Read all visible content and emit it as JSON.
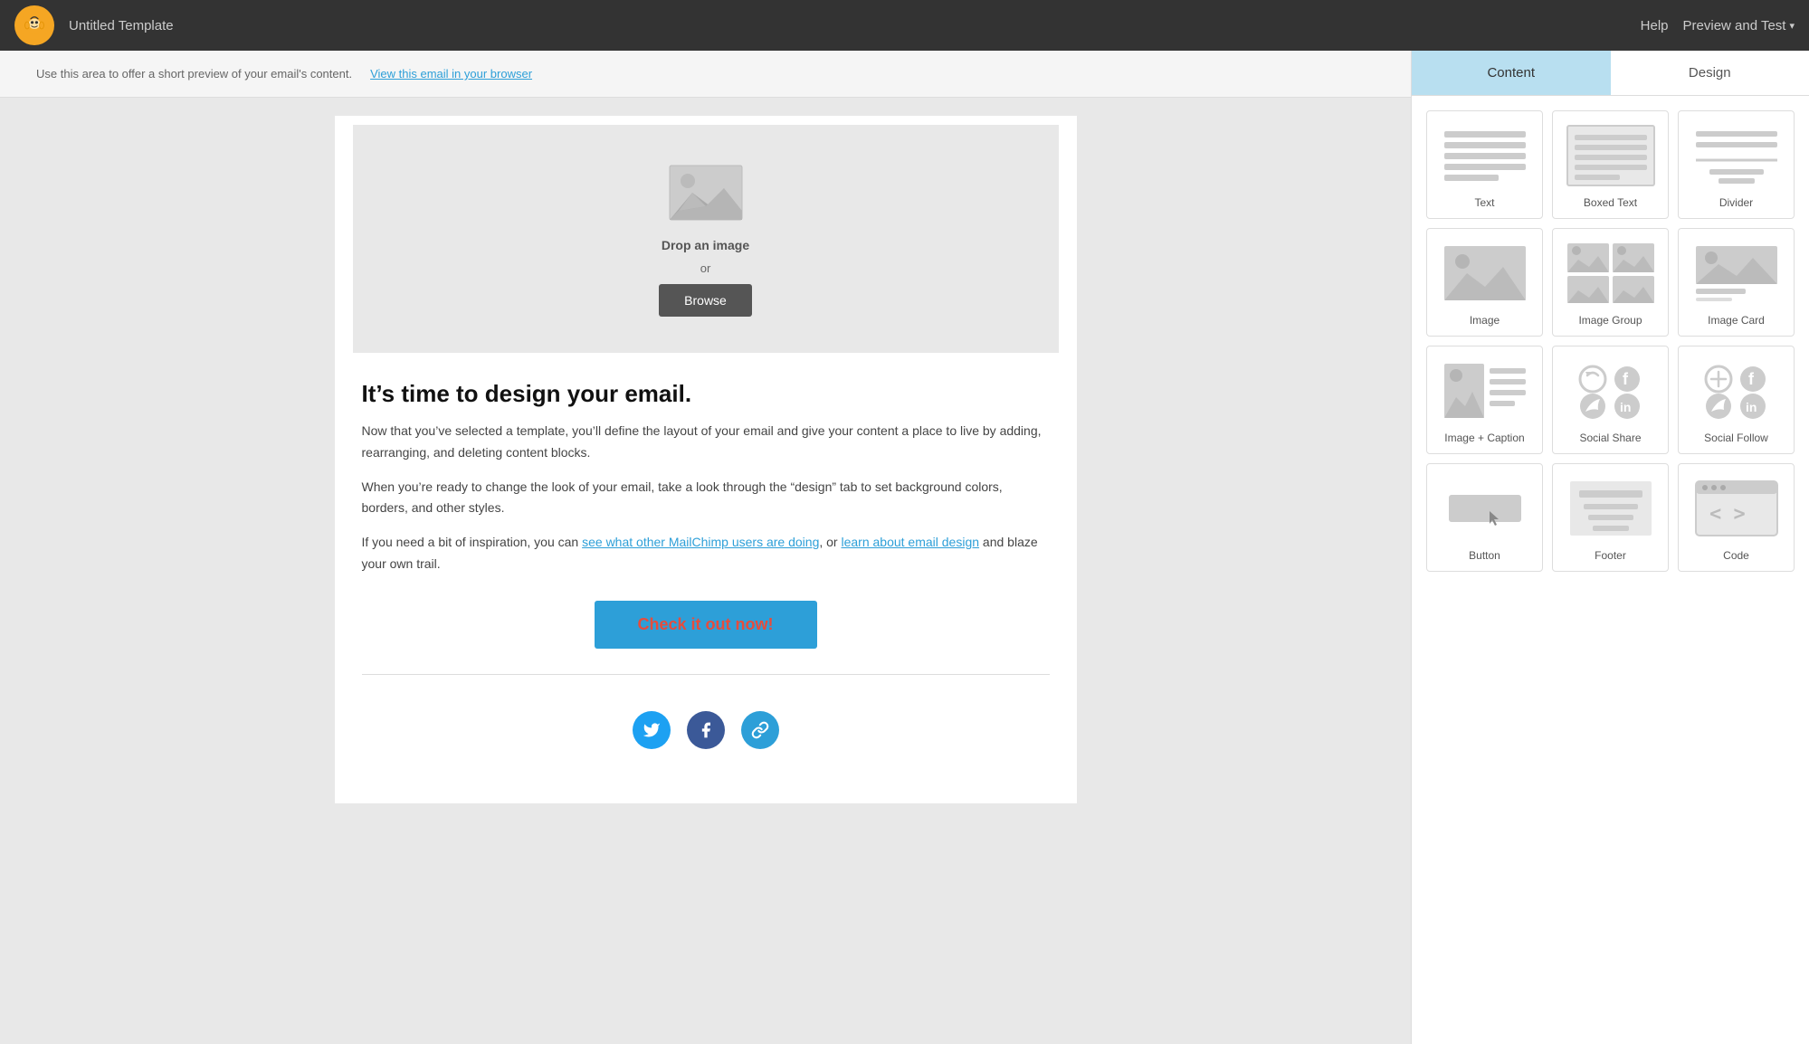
{
  "topnav": {
    "title": "Untitled Template",
    "help_label": "Help",
    "preview_label": "Preview and Test"
  },
  "preheader": {
    "text": "Use this area to offer a short preview of your email's content.",
    "link_text": "View this email in your browser"
  },
  "dropzone": {
    "drop_text": "Drop an image",
    "drop_or": "or",
    "browse_label": "Browse"
  },
  "email_content": {
    "heading": "It’s time to design your email.",
    "para1": "Now that you’ve selected a template, you’ll define the layout of your email and give your content a place to live by adding, rearranging, and deleting content blocks.",
    "para2": "When you’re ready to change the look of your email, take a look through the “design” tab to set background colors, borders, and other styles.",
    "para3_prefix": "If you need a bit of inspiration, you can ",
    "link1_text": "see what other MailChimp users are doing",
    "para3_mid": ", or ",
    "link2_text": "learn about email design",
    "para3_suffix": " and blaze your own trail.",
    "cta_label": "Check it out now!"
  },
  "panel": {
    "content_tab": "Content",
    "design_tab": "Design",
    "blocks": [
      {
        "id": "text",
        "label": "Text"
      },
      {
        "id": "boxed-text",
        "label": "Boxed Text"
      },
      {
        "id": "divider",
        "label": "Divider"
      },
      {
        "id": "image",
        "label": "Image"
      },
      {
        "id": "image-group",
        "label": "Image Group"
      },
      {
        "id": "image-card",
        "label": "Image Card"
      },
      {
        "id": "image-caption",
        "label": "Image + Caption"
      },
      {
        "id": "social-share",
        "label": "Social Share"
      },
      {
        "id": "social-follow",
        "label": "Social Follow"
      },
      {
        "id": "button",
        "label": "Button"
      },
      {
        "id": "footer",
        "label": "Footer"
      },
      {
        "id": "code",
        "label": "Code"
      }
    ]
  }
}
